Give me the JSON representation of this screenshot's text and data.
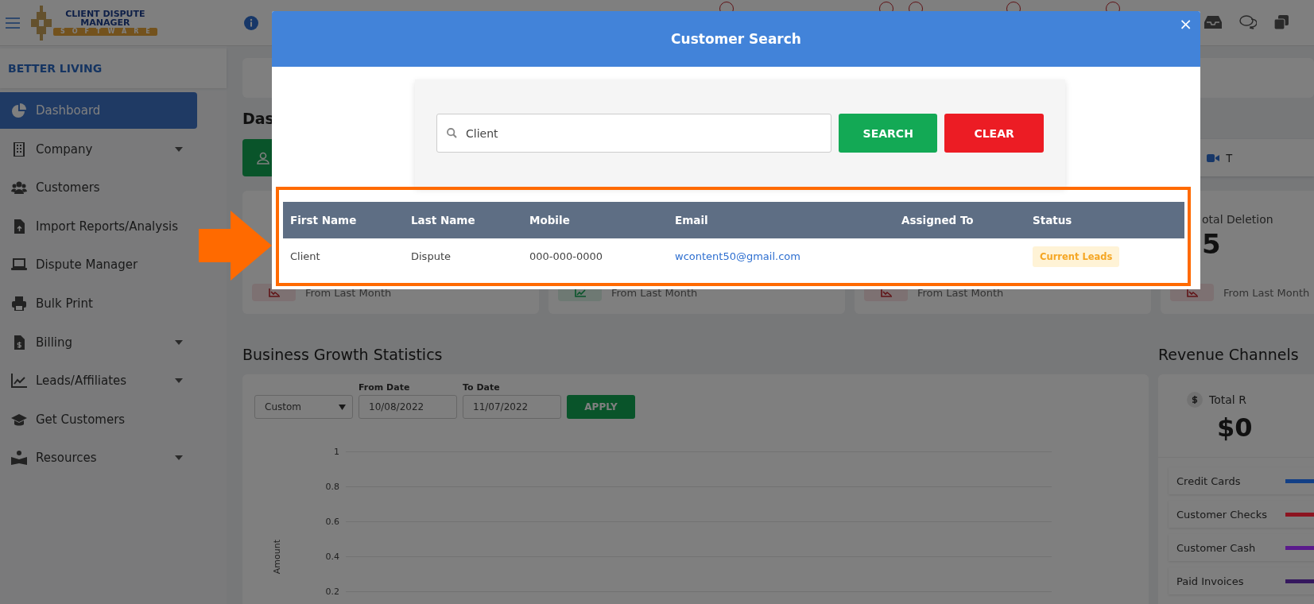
{
  "header": {
    "logo_lines": [
      "CLIENT DISPUTE",
      "MANAGER",
      "SOFTWARE"
    ]
  },
  "sidebar": {
    "company": "BETTER LIVING",
    "items": [
      {
        "label": "Dashboard",
        "selected": true,
        "has_submenu": false
      },
      {
        "label": "Company",
        "selected": false,
        "has_submenu": true
      },
      {
        "label": "Customers",
        "selected": false,
        "has_submenu": false
      },
      {
        "label": "Import Reports/Analysis",
        "selected": false,
        "has_submenu": false
      },
      {
        "label": "Dispute Manager",
        "selected": false,
        "has_submenu": false
      },
      {
        "label": "Bulk Print",
        "selected": false,
        "has_submenu": false
      },
      {
        "label": "Billing",
        "selected": false,
        "has_submenu": true
      },
      {
        "label": "Leads/Affiliates",
        "selected": false,
        "has_submenu": true
      },
      {
        "label": "Get Customers",
        "selected": false,
        "has_submenu": false
      },
      {
        "label": "Resources",
        "selected": false,
        "has_submenu": true
      }
    ]
  },
  "dashboard": {
    "title": "Das",
    "right_button": "T",
    "stat_cards": [
      {
        "rising": false,
        "note": "From Last Month"
      },
      {
        "rising": true,
        "note": "From Last Month"
      },
      {
        "rising": false,
        "note": "From Last Month"
      },
      {
        "rising": false,
        "label": "otal Deletion",
        "value": "5",
        "note": "From Last Month"
      }
    ],
    "business_growth": {
      "title": "Business Growth Statistics",
      "range": "Custom",
      "from_label": "From Date",
      "from_value": "10/08/2022",
      "to_label": "To Date",
      "to_value": "11/07/2022",
      "apply": "APPLY",
      "chart": {
        "ylabel": "Amount",
        "yticks": [
          "1",
          "0.8",
          "0.6",
          "0.4",
          "0.2"
        ]
      }
    },
    "revenue": {
      "title": "Revenue Channels",
      "total_label": "Total R",
      "total": "$0",
      "channels": [
        {
          "name": "Credit Cards",
          "color": "#123f86"
        },
        {
          "name": "Customer Checks",
          "color": "#8c1420"
        },
        {
          "name": "Customer Cash",
          "color": "#5a1a8c"
        },
        {
          "name": "Paid Invoices",
          "color": "#35185e"
        }
      ]
    }
  },
  "modal": {
    "title": "Customer Search",
    "close": "×",
    "search_value": "Client",
    "search_button": "SEARCH",
    "clear_button": "CLEAR",
    "table": {
      "columns": [
        "First Name",
        "Last Name",
        "Mobile",
        "Email",
        "Assigned To",
        "Status"
      ],
      "rows": [
        {
          "first_name": "Client",
          "last_name": "Dispute",
          "mobile": "000-000-0000",
          "email": "wcontent50@gmail.com",
          "status": "Current Leads"
        }
      ]
    }
  }
}
